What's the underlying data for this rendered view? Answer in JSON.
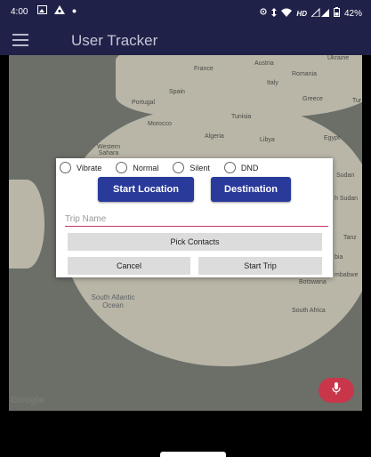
{
  "status_bar": {
    "time": "4:00",
    "notification_icons": [
      "photo-icon",
      "vpn-icon",
      "dot-icon"
    ],
    "system_icons": [
      "location-icon",
      "data-transfer-icon",
      "wifi-icon",
      "signal-icon",
      "battery-icon"
    ],
    "network_text": "HD",
    "battery_text": "42%"
  },
  "app_bar": {
    "title": "User Tracker",
    "menu_icon": "hamburger-menu-icon"
  },
  "map": {
    "labels": [
      "Ukraine",
      "Romania",
      "Austria",
      "France",
      "Italy",
      "Spain",
      "Portugal",
      "Greece",
      "Tur",
      "Tunisia",
      "Morocco",
      "Algeria",
      "Libya",
      "Egypt",
      "Western Sahara",
      "Sudan",
      "h Sudan",
      "Tanz",
      "bia",
      "mbabwe",
      "Botswana",
      "South Africa",
      "South Atlantic Ocean"
    ],
    "attribution": "Google"
  },
  "dialog": {
    "ring_modes": [
      {
        "label": "Vibrate",
        "selected": false
      },
      {
        "label": "Normal",
        "selected": false
      },
      {
        "label": "Silent",
        "selected": false
      },
      {
        "label": "DND",
        "selected": false
      }
    ],
    "start_location_label": "Start Location",
    "destination_label": "Destination",
    "trip_name_placeholder": "Trip Name",
    "trip_name_value": "",
    "pick_contacts_label": "Pick Contacts",
    "cancel_label": "Cancel",
    "start_trip_label": "Start Trip"
  },
  "fab": {
    "icon": "microphone-icon"
  },
  "colors": {
    "app_bar": "#1f2148",
    "primary_button": "#2a3a9a",
    "accent": "#c9364a",
    "input_underline": "#c0386a"
  }
}
